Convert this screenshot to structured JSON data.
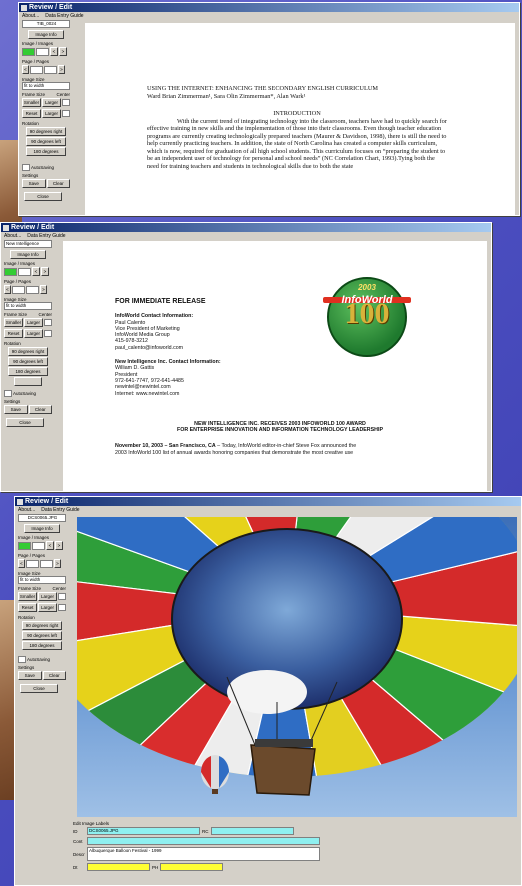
{
  "win1": {
    "title": "Review / Edit",
    "menu": [
      "About...",
      "Data Entry Guide"
    ],
    "file_id": "TIB_0024",
    "image_info": "Image Info",
    "image_images_label": "Image / Images",
    "page_pages_label": "Page / Pages",
    "image_size_label": "Image Size",
    "size_value": "fit to width",
    "frame_size_label": "Frame Size",
    "center_label": "Center",
    "smaller": "Smaller",
    "larger": "Larger",
    "reset": "Reset",
    "rotation_label": "Rotation",
    "rot_right": "90 degrees right",
    "rot_left": "90 degrees left",
    "rot_180": "180 degrees",
    "autosaving": "AutoSaving",
    "settings_label": "Settings",
    "save": "Save",
    "clear": "Clear",
    "close": "Close",
    "doc": {
      "title": "USING THE INTERNET: ENHANCING THE SECONDARY ENGLISH CURRICULUM",
      "authors": "Ward Brian Zimmerman¹, Sara Olin Zimmerman*, Alan Wark¹",
      "heading": "INTRODUCTION",
      "body": "With the current trend of integrating technology into the classroom, teachers have had to quickly search for effective training in new skills and the implementation of those into their classrooms. Even though teacher education programs are currently creating technologically prepared teachers (Maurer & Davidson, 1998), there is still the need to help currently practicing teachers. In addition, the state of North Carolina has created a computer skills curriculum, which is now, required for graduation of all high school students. This curriculum focuses on “preparing the student to be an independent user of technology for personal and school needs” (NC Correlation Chart, 1993).Tying both the need for training teachers and students in technological skills due to both the state"
    }
  },
  "win2": {
    "title": "Review / Edit",
    "menu": [
      "About...",
      "Data Entry Guide"
    ],
    "file_id": "New Intelligence Press Rel",
    "doc": {
      "release": "FOR IMMEDIATE RELEASE",
      "contact1_head": "InfoWorld Contact Information:",
      "contact1": [
        "Paul Calento",
        "Vice President of Marketing",
        "InfoWorld Media Group",
        "415-978-3212",
        "paul_calento@infoworld.com"
      ],
      "contact2_head": "New Intelligence Inc. Contact Information:",
      "contact2": [
        "William D. Gattis",
        "President",
        "972-641-7747, 972-641-4485",
        "newintel@newintel.com",
        "Internet:  www.newintel.com"
      ],
      "logo_year": "2003",
      "logo_brand": "InfoWorld",
      "logo_number": "100",
      "headline1": "NEW INTELLIGENCE INC. RECEIVES 2003 INFOWORLD 100 AWARD",
      "headline2": "FOR ENTERPRISE INNOVATION AND INFORMATION TECHNOLOGY LEADERSHIP",
      "dateline": "November 10, 2003 – San Francisco, CA",
      "lead": " – Today, InfoWorld editor-in-chief Steve Fox announced the",
      "lead2": "2003 InfoWorld 100 list of annual awards honoring companies that demonstrate the most creative use"
    }
  },
  "win3": {
    "title": "Review / Edit",
    "menu": [
      "About...",
      "Data Entry Guide"
    ],
    "file_id": "DCS0065.JPG",
    "edit_labels_title": "Edit Image Labels",
    "label_row1_tag": "ID",
    "label_row1_value": "DCS0065.JPG",
    "label_row1_tag2": "RC",
    "label_row2_tag": "Cont",
    "label_row3_tag": "Descr",
    "label_row3_value": "Albuquerque Balloon Festival - 1999",
    "label_row4_tag": "Dt",
    "label_row4_tag2": "PH"
  }
}
